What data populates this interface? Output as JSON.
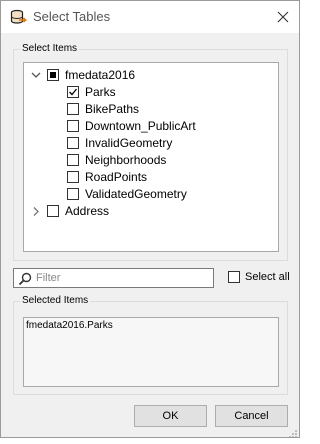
{
  "window": {
    "title": "Select Tables"
  },
  "select_items": {
    "group_label": "Select Items",
    "tree": [
      {
        "label": "fmedata2016",
        "expanded": true,
        "check_state": "partial",
        "children": [
          {
            "label": "Parks",
            "checked": true
          },
          {
            "label": "BikePaths",
            "checked": false
          },
          {
            "label": "Downtown_PublicArt",
            "checked": false
          },
          {
            "label": "InvalidGeometry",
            "checked": false
          },
          {
            "label": "Neighborhoods",
            "checked": false
          },
          {
            "label": "RoadPoints",
            "checked": false
          },
          {
            "label": "ValidatedGeometry",
            "checked": false
          }
        ]
      },
      {
        "label": "Address",
        "expanded": false,
        "check_state": "unchecked",
        "children": []
      }
    ]
  },
  "filter": {
    "placeholder": "Filter",
    "value": ""
  },
  "select_all": {
    "label": "Select all",
    "checked": false
  },
  "selected_items": {
    "group_label": "Selected Items",
    "items": [
      "fmedata2016.Parks"
    ]
  },
  "buttons": {
    "ok": "OK",
    "cancel": "Cancel"
  },
  "icons": {
    "app": "fme-database-icon",
    "close": "close-icon",
    "search": "search-icon"
  }
}
